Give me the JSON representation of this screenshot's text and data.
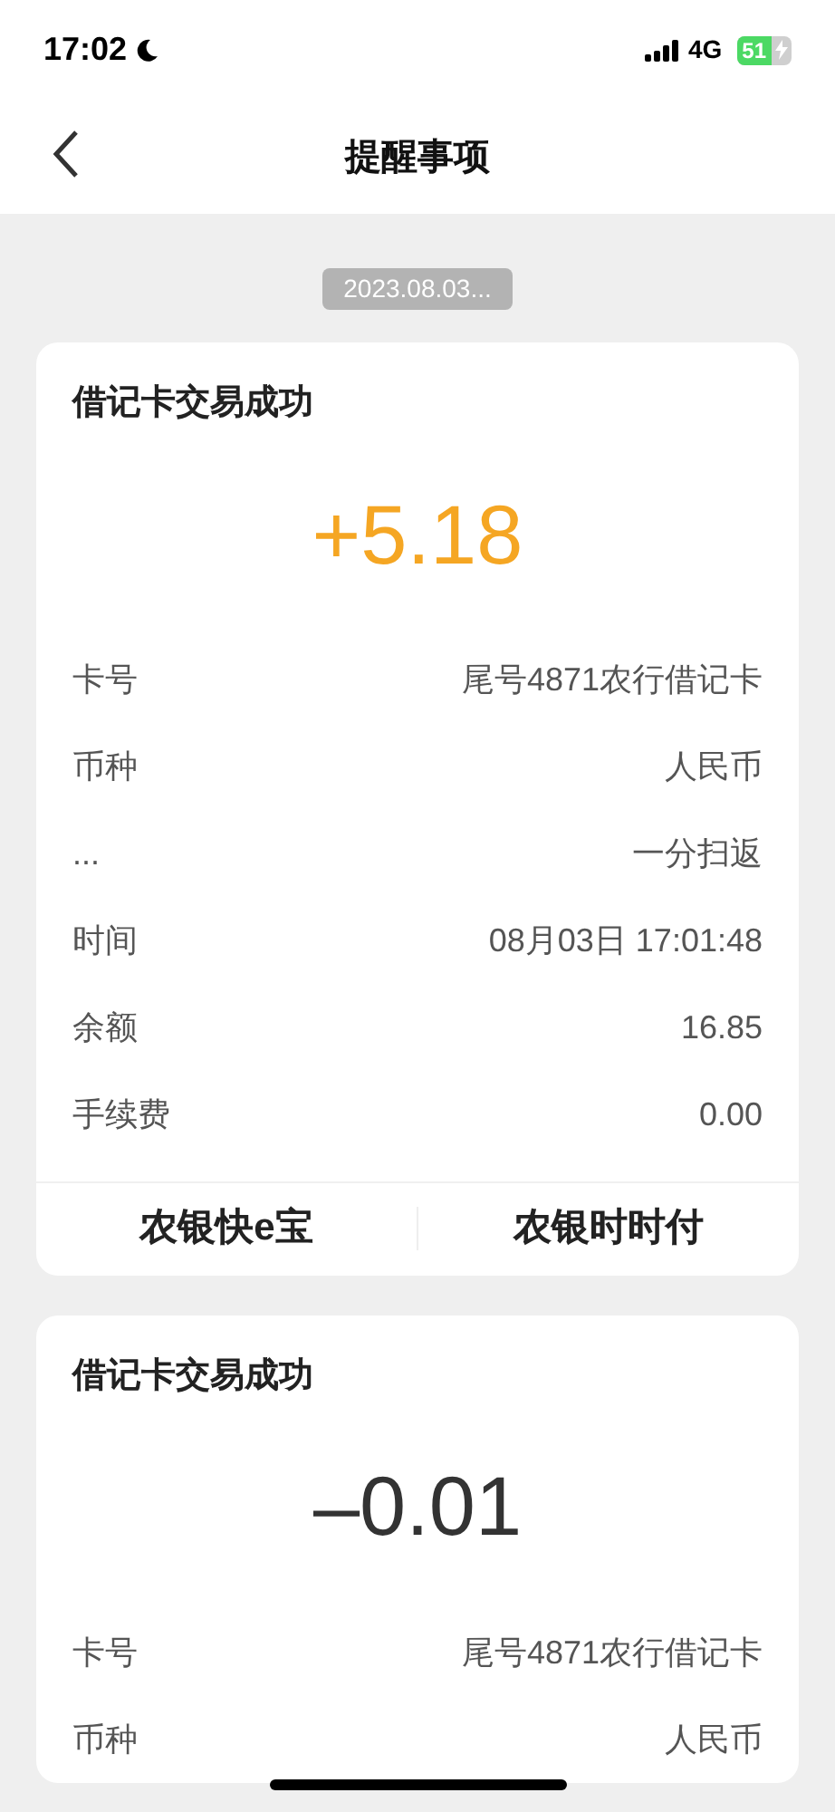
{
  "status_bar": {
    "time": "17:02",
    "network": "4G",
    "battery": "51"
  },
  "header": {
    "title": "提醒事项"
  },
  "date_chip": "2023.08.03...",
  "cards": [
    {
      "title": "借记卡交易成功",
      "amount": "+5.18",
      "kind": "credit",
      "rows": [
        {
          "label": "卡号",
          "value": "尾号4871农行借记卡"
        },
        {
          "label": "币种",
          "value": "人民币"
        },
        {
          "label": "...",
          "value": "一分扫返"
        },
        {
          "label": "时间",
          "value": "08月03日 17:01:48"
        },
        {
          "label": "余额",
          "value": "16.85"
        },
        {
          "label": "手续费",
          "value": "0.00"
        }
      ],
      "actions": [
        "农银快e宝",
        "农银时时付"
      ]
    },
    {
      "title": "借记卡交易成功",
      "amount": "–0.01",
      "kind": "debit",
      "rows": [
        {
          "label": "卡号",
          "value": "尾号4871农行借记卡"
        },
        {
          "label": "币种",
          "value": "人民币"
        }
      ]
    }
  ]
}
